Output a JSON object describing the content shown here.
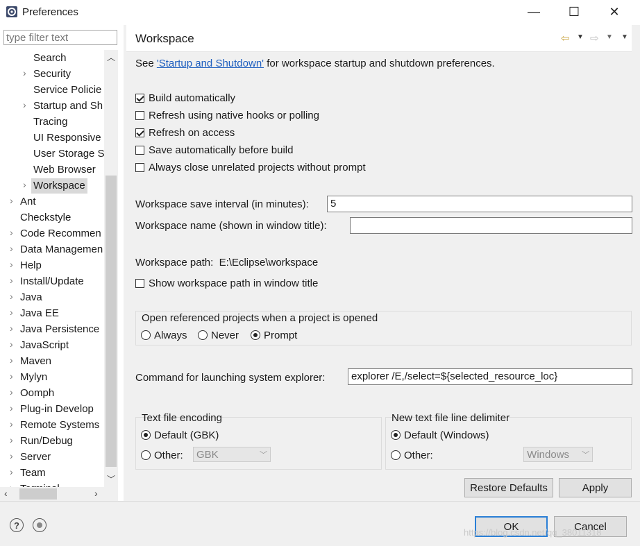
{
  "window": {
    "title": "Preferences",
    "minimize": "—",
    "maximize": "☐",
    "close": "✕"
  },
  "sidebar": {
    "filter_placeholder": "type filter text",
    "items": [
      {
        "label": "Search",
        "indent": 1,
        "arrow": false
      },
      {
        "label": "Security",
        "indent": 1,
        "arrow": true
      },
      {
        "label": "Service Policie",
        "indent": 1,
        "arrow": false
      },
      {
        "label": "Startup and Sh",
        "indent": 1,
        "arrow": true
      },
      {
        "label": "Tracing",
        "indent": 1,
        "arrow": false
      },
      {
        "label": "UI Responsive",
        "indent": 1,
        "arrow": false
      },
      {
        "label": "User Storage S",
        "indent": 1,
        "arrow": false
      },
      {
        "label": "Web Browser",
        "indent": 1,
        "arrow": false
      },
      {
        "label": "Workspace",
        "indent": 1,
        "arrow": true,
        "selected": true
      },
      {
        "label": "Ant",
        "indent": 0,
        "arrow": true
      },
      {
        "label": "Checkstyle",
        "indent": 0,
        "arrow": false
      },
      {
        "label": "Code Recommen",
        "indent": 0,
        "arrow": true
      },
      {
        "label": "Data Managemen",
        "indent": 0,
        "arrow": true
      },
      {
        "label": "Help",
        "indent": 0,
        "arrow": true
      },
      {
        "label": "Install/Update",
        "indent": 0,
        "arrow": true
      },
      {
        "label": "Java",
        "indent": 0,
        "arrow": true
      },
      {
        "label": "Java EE",
        "indent": 0,
        "arrow": true
      },
      {
        "label": "Java Persistence",
        "indent": 0,
        "arrow": true
      },
      {
        "label": "JavaScript",
        "indent": 0,
        "arrow": true
      },
      {
        "label": "Maven",
        "indent": 0,
        "arrow": true
      },
      {
        "label": "Mylyn",
        "indent": 0,
        "arrow": true
      },
      {
        "label": "Oomph",
        "indent": 0,
        "arrow": true
      },
      {
        "label": "Plug-in Develop",
        "indent": 0,
        "arrow": true
      },
      {
        "label": "Remote Systems",
        "indent": 0,
        "arrow": true
      },
      {
        "label": "Run/Debug",
        "indent": 0,
        "arrow": true
      },
      {
        "label": "Server",
        "indent": 0,
        "arrow": true
      },
      {
        "label": "Team",
        "indent": 0,
        "arrow": true
      },
      {
        "label": "Terminal",
        "indent": 0,
        "arrow": true
      }
    ]
  },
  "panel": {
    "title": "Workspace",
    "intro_prefix": "See ",
    "intro_link": "'Startup and Shutdown'",
    "intro_suffix": " for workspace startup and shutdown preferences.",
    "checkboxes": [
      {
        "label": "Build automatically",
        "checked": true
      },
      {
        "label": "Refresh using native hooks or polling",
        "checked": false
      },
      {
        "label": "Refresh on access",
        "checked": true
      },
      {
        "label": "Save automatically before build",
        "checked": false
      },
      {
        "label": "Always close unrelated projects without prompt",
        "checked": false
      }
    ],
    "save_interval_label": "Workspace save interval (in minutes):",
    "save_interval_value": "5",
    "name_label": "Workspace name (shown in window title):",
    "name_value": "",
    "path_label": "Workspace path:",
    "path_value": "E:\\Eclipse\\workspace",
    "show_path_label": "Show workspace path in window title",
    "open_ref": {
      "title": "Open referenced projects when a project is opened",
      "options": [
        "Always",
        "Never",
        "Prompt"
      ],
      "selected": "Prompt"
    },
    "explorer_label": "Command for launching system explorer:",
    "explorer_value": "explorer /E,/select=${selected_resource_loc}",
    "encoding": {
      "title": "Text file encoding",
      "default_label": "Default (GBK)",
      "other_label": "Other:",
      "other_value": "GBK",
      "selected": "default"
    },
    "delimiter": {
      "title": "New text file line delimiter",
      "default_label": "Default (Windows)",
      "other_label": "Other:",
      "other_value": "Windows",
      "selected": "default"
    },
    "restore_label": "Restore Defaults",
    "apply_label": "Apply"
  },
  "footer": {
    "ok_label": "OK",
    "cancel_label": "Cancel",
    "help_icon": "?",
    "watermark": "https://blog.csdn.net/qq_38011318"
  }
}
